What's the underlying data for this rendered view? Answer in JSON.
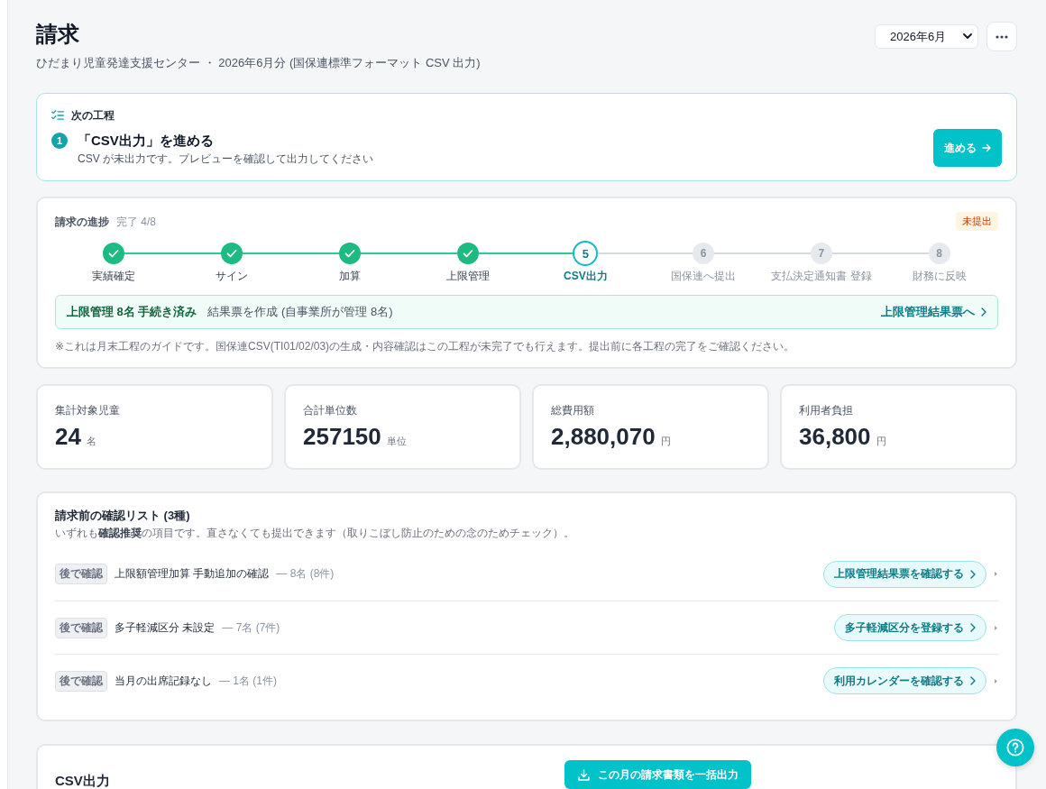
{
  "page": {
    "title": "請求",
    "subtitle": "ひだまり児童発達支援センター ・ 2026年6月分 (国保連標準フォーマット CSV 出力)",
    "month_select": {
      "value": "2026年6月"
    }
  },
  "next_step": {
    "heading": "次の工程",
    "number": "1",
    "title": "「CSV出力」を進める",
    "description": "CSV が未出力です。プレビューを確認して出力してください",
    "button": "進める"
  },
  "progress": {
    "title": "請求の進捗",
    "summary": "完了 4/8",
    "status_badge": "未提出",
    "steps": [
      {
        "label": "実績確定",
        "done": true,
        "current": false
      },
      {
        "label": "サイン",
        "done": true,
        "current": false
      },
      {
        "label": "加算",
        "done": true,
        "current": false
      },
      {
        "label": "上限管理",
        "done": true,
        "current": false
      },
      {
        "number": "5",
        "label": "CSV出力",
        "done": false,
        "current": true
      },
      {
        "number": "6",
        "label": "国保連へ提出",
        "done": false,
        "current": false
      },
      {
        "number": "7",
        "label": "支払決定通知書 登録",
        "done": false,
        "current": false
      },
      {
        "number": "8",
        "label": "財務に反映",
        "done": false,
        "current": false
      }
    ],
    "banner": {
      "title": "上限管理 8名 手続き済み",
      "detail": "結果票を作成 (自事業所が管理 8名)",
      "link": "上限管理結果票へ"
    },
    "note": "※これは月末工程のガイドです。国保連CSV(TI01/02/03)の生成・内容確認はこの工程が未完了でも行えます。提出前に各工程の完了をご確認ください。"
  },
  "stats": [
    {
      "label": "集計対象児童",
      "value": "24",
      "unit": "名"
    },
    {
      "label": "合計単位数",
      "value": "257150",
      "unit": "単位"
    },
    {
      "label": "総費用額",
      "value": "2,880,070",
      "unit": "円"
    },
    {
      "label": "利用者負担",
      "value": "36,800",
      "unit": "円"
    }
  ],
  "checklist": {
    "title": "請求前の確認リスト (3種)",
    "description": "いずれも**確認推奨**の項目です。直さなくても提出できます（取りこぼし防止のための念のためチェック）。",
    "items": [
      {
        "tag": "後で確認",
        "title": "上限額管理加算 手動追加の確認",
        "count": "— 8名 (8件)",
        "action": "上限管理結果票を確認する"
      },
      {
        "tag": "後で確認",
        "title": "多子軽減区分 未設定",
        "count": "— 7名 (7件)",
        "action": "多子軽減区分を登録する"
      },
      {
        "tag": "後で確認",
        "title": "当月の出席記録なし",
        "count": "— 1名 (1件)",
        "action": "利用カレンダーを確認する"
      }
    ]
  },
  "export": {
    "title": "CSV出力",
    "button": "この月の請求書類を一括出力"
  }
}
